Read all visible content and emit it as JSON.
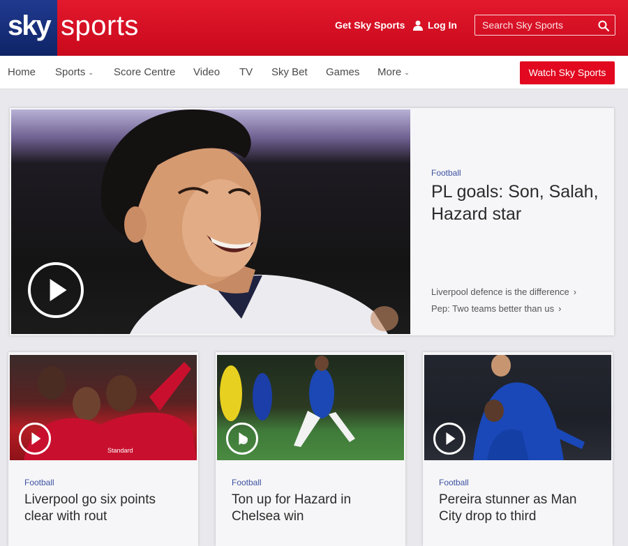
{
  "header": {
    "logo_sky": "sky",
    "logo_sports": "sports",
    "get_sky_sports": "Get Sky Sports",
    "log_in": "Log In",
    "search_placeholder": "Search Sky Sports"
  },
  "nav": {
    "items": [
      {
        "label": "Home",
        "has_dropdown": false
      },
      {
        "label": "Sports",
        "has_dropdown": true
      },
      {
        "label": "Score Centre",
        "has_dropdown": false
      },
      {
        "label": "Video",
        "has_dropdown": false
      },
      {
        "label": "TV",
        "has_dropdown": false
      },
      {
        "label": "Sky Bet",
        "has_dropdown": false
      },
      {
        "label": "Games",
        "has_dropdown": false
      },
      {
        "label": "More",
        "has_dropdown": true
      }
    ],
    "watch_button": "Watch Sky Sports"
  },
  "hero": {
    "category": "Football",
    "title": "PL goals: Son, Salah, Hazard star",
    "links": [
      "Liverpool defence is the difference",
      "Pep: Two teams better than us"
    ]
  },
  "cards": [
    {
      "category": "Football",
      "title": "Liverpool go six points clear with rout"
    },
    {
      "category": "Football",
      "title": "Ton up for Hazard in Chelsea win"
    },
    {
      "category": "Football",
      "title": "Pereira stunner as Man City drop to third"
    }
  ],
  "colors": {
    "brand_red": "#e1081f",
    "brand_blue": "#1a3383",
    "category_blue": "#3d52a0"
  }
}
